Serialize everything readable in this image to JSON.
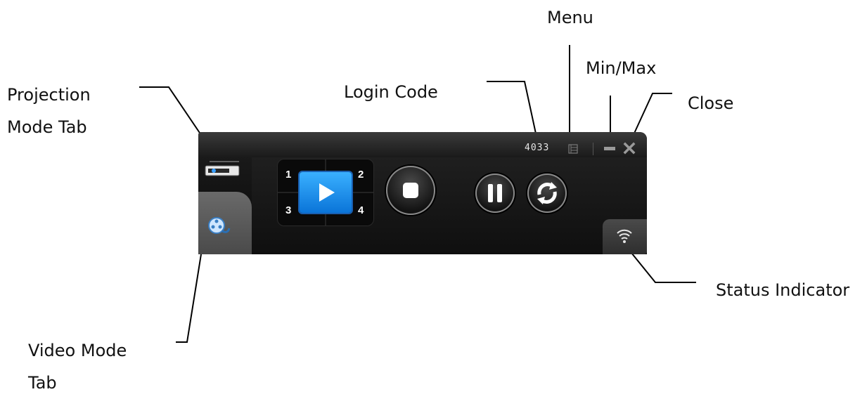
{
  "callouts": {
    "menu": "Menu",
    "min_max": "Min/Max",
    "login_code": "Login Code",
    "close": "Close",
    "projection_mode_tab": "Projection\nMode Tab",
    "status_indicator": "Status Indicator",
    "video_mode_tab": "Video Mode\nTab"
  },
  "app": {
    "login_code_value": "4033",
    "quad_labels": [
      "1",
      "2",
      "3",
      "4"
    ]
  },
  "icons": {
    "menu": "menu-icon",
    "minimize": "minimize-icon",
    "close": "close-icon",
    "projection": "projector-icon",
    "video": "film-reel-icon",
    "play": "play-icon",
    "stop": "stop-icon",
    "pause": "pause-icon",
    "refresh": "refresh-icon",
    "status": "wifi-icon"
  },
  "colors": {
    "window_bg": "#111111",
    "accent_blue": "#0a74d8",
    "text_light": "#e6e6e6"
  }
}
